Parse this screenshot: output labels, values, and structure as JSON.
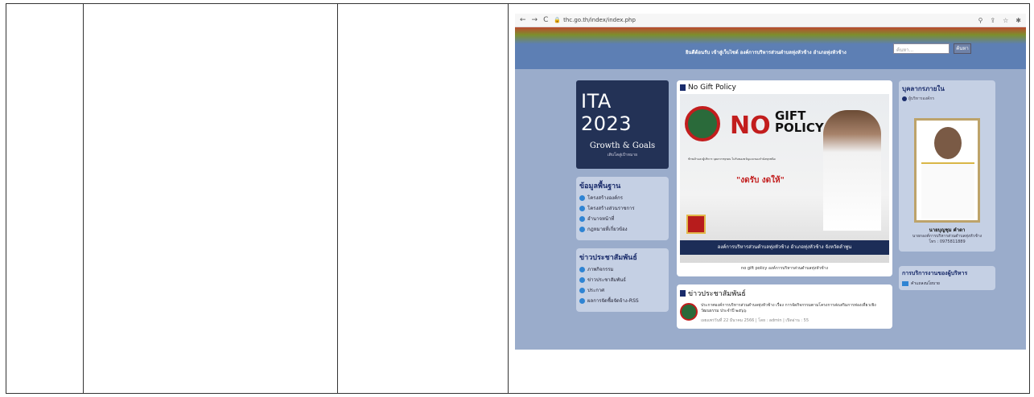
{
  "browser": {
    "url_host": "thc.go.th",
    "url_path": "/index/index.php"
  },
  "banner": {
    "marquee": "ยินดีต้อนรับ เข้าสู่เว็บไซต์ องค์การบริหารส่วนตำบลทุ่งหัวช้าง อำเภอทุ่งหัวช้าง",
    "search_placeholder": "ค้นหา...",
    "search_button": "ค้นหา"
  },
  "ita": {
    "title_main": "ITA",
    "title_year": "2023",
    "subtitle": "Growth & Goals",
    "subtitle2": "เติบโตสู่เป้าหมาย"
  },
  "left_menus": [
    {
      "heading": "ข้อมูลพื้นฐาน",
      "items": [
        "โครงสร้างองค์กร",
        "โครงสร้างส่วนราชการ",
        "อำนาจหน้าที่",
        "กฎหมายที่เกี่ยวข้อง"
      ]
    },
    {
      "heading": "ข่าวประชาสัมพันธ์",
      "items": [
        "ภาพกิจกรรม",
        "ข่าวประชาสัมพันธ์",
        "ประกาศ",
        "ผลการจัดซื้อจัดจ้าง-RSS"
      ]
    }
  ],
  "nogift": {
    "panel_title": "No Gift Policy",
    "big_no": "NO",
    "gift_line1": "GIFT",
    "gift_line2": "POLICY",
    "small_text": "ข้าพเจ้าและผู้บริหาร บุคลากรทุกคน ไม่รับของขวัญและของกำนัลทุกชนิด",
    "quote": "\"งดรับ งดให้\"",
    "footer": "องค์การบริหารส่วนตำบลทุ่งหัวช้าง อำเภอทุ่งหัวช้าง จังหวัดลำพูน",
    "caption": "no gift policy องค์การบริหารส่วนตำบลทุ่งหัวช้าง"
  },
  "news": {
    "title": "ข่าวประชาสัมพันธ์",
    "item_text": "ประกาศองค์การบริหารส่วนตำบลทุ่งหัวช้าง เรื่อง การจัดกิจกรรมตามโครงการส่งเสริมการท่องเที่ยวเชิงวัฒนธรรม ประจำปี ๒๕๖๖",
    "item_meta": "เผยแพร่วันที่ 22 มีนาคม 2566 | โดย : admin | เปิดอ่าน : 55"
  },
  "personnel": {
    "title": "บุคลากรภายใน",
    "sub": "ผู้บริหารองค์กร",
    "name": "นายบุญชุม คำตา",
    "position": "นายกองค์การบริหารส่วนตำบลทุ่งหัวช้าง",
    "phone": "โทร : 0975811889"
  },
  "services": {
    "title": "การบริการงานของผู้บริหาร",
    "item": "คำแถลงนโยบาย"
  }
}
